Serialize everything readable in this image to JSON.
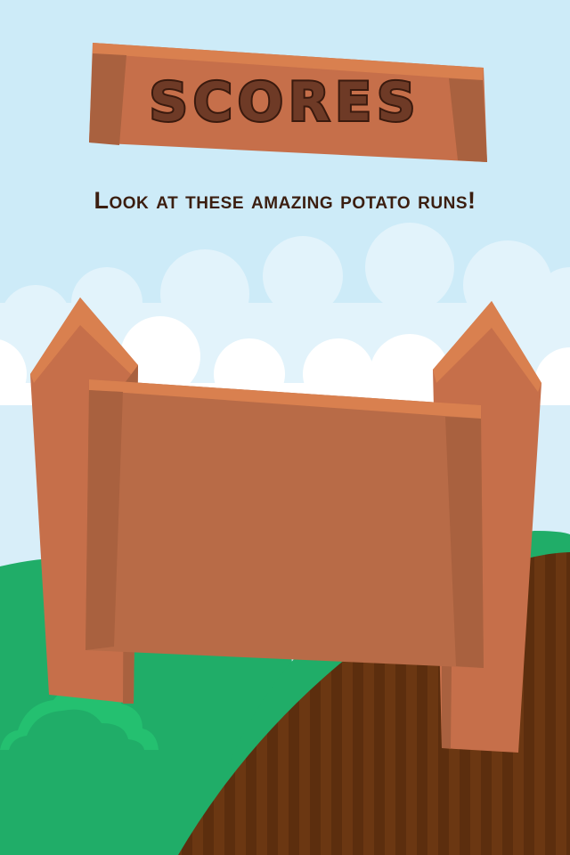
{
  "screen": {
    "title": "SCORES",
    "subtitle": "Look at these amazing potato runs!"
  },
  "colors": {
    "sky": "#cdebf8",
    "cloud": "#ffffff",
    "wood": "#c66f4a",
    "wood_dark": "#a9613f",
    "wood_light": "#d9804f",
    "grass": "#20ad68",
    "bush": "#24c070",
    "soil": "#6b3712",
    "soil_dark": "#5c2e0e",
    "title_text": "#6e3a26",
    "title_outline": "#3a1a0e",
    "subtitle_text": "#3b1e10"
  },
  "icons": [
    "cloud-icon",
    "bush-icon",
    "wooden-signpost-icon"
  ]
}
